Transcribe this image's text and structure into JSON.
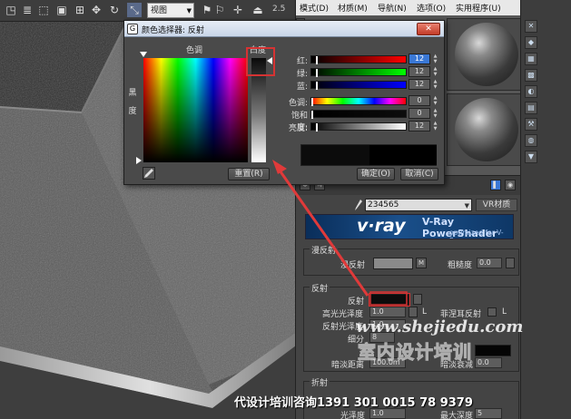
{
  "toolbar": {
    "view_select": "视图",
    "number": "2.5"
  },
  "material_editor": {
    "menu": [
      "模式(D)",
      "材质(M)",
      "导航(N)",
      "选项(O)",
      "实用程序(U)"
    ],
    "material_name": "234565",
    "material_type": "VR材质",
    "banner": {
      "logo": "v·ray",
      "title": "V-Ray PowerShader",
      "subtitle": "optimized for V-Ray"
    },
    "diffuse": {
      "section_title": "漫反射",
      "diffuse_label": "漫反射",
      "map_button": "M",
      "roughness_label": "粗糙度",
      "roughness_value": "0.0"
    },
    "reflection": {
      "section_title": "反射",
      "reflect_label": "反射",
      "fresnel_label": "菲涅耳反射",
      "fresnel_lock": "L",
      "hilight_label": "高光光泽度",
      "hilight_value": "1.0",
      "hilight_lock": "L",
      "glossiness_label": "反射光泽度",
      "glossiness_value": "1.0",
      "subdivs_label": "细分",
      "subdivs_value": "8",
      "dim_label": "暗淡距离",
      "dim_value": "100.0m",
      "dim_falloff_label": "暗淡衰减",
      "dim_falloff_value": "0.0"
    },
    "refraction": {
      "section_title": "折射",
      "glossiness_label": "光泽度",
      "glossiness_value": "1.0",
      "max_depth_label": "最大深度",
      "max_depth_value": "5"
    }
  },
  "color_dialog": {
    "title": "颜色选择器: 反射",
    "close_label": "✕",
    "hue_label": "色调",
    "whiteness_label": "白度",
    "blackness_label_1": "黑",
    "blackness_label_2": "度",
    "red_label": "红:",
    "red_value": "12",
    "green_label": "绿:",
    "green_value": "12",
    "blue_label": "蓝:",
    "blue_value": "12",
    "hue_ch_label": "色调:",
    "hue_value": "0",
    "sat_label": "饱和度:",
    "sat_value": "0",
    "value_label": "亮度:",
    "value_value": "12",
    "reset_button": "重置(R)",
    "ok_button": "确定(O)",
    "cancel_button": "取消(C)",
    "channel_fraction": 0.047
  },
  "overlay": {
    "watermark_url": "www.shejiedu.com",
    "watermark_cn": "室内设计培训",
    "footer": "代设计培训咨询1391 301  0015 78 9379"
  },
  "colors": {
    "accent_selected": "#3a78d6",
    "highlight_red": "#d63333",
    "reflect_swatch": "#0c0c0c"
  }
}
